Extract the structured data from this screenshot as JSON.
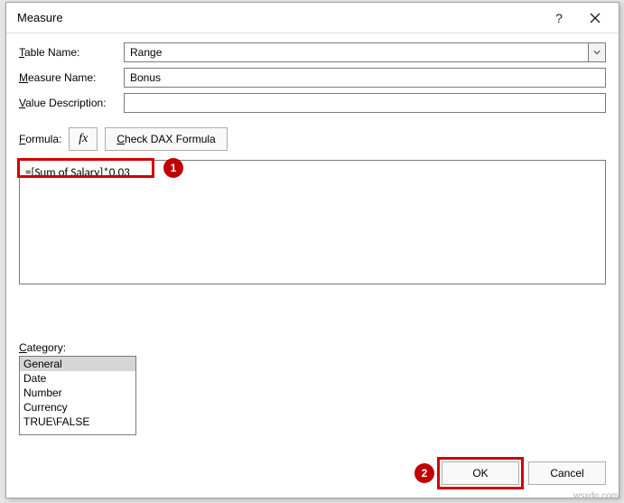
{
  "dialog": {
    "title": "Measure",
    "help_symbol": "?",
    "close_label": "Close"
  },
  "labels": {
    "table_name_pre": "T",
    "table_name_post": "able Name:",
    "measure_name_pre": "M",
    "measure_name_post": "easure Name:",
    "value_desc_pre": "V",
    "value_desc_post": "alue Description:",
    "formula_pre": "F",
    "formula_post": "ormula:",
    "category_pre": "C",
    "category_post": "ategory:"
  },
  "fields": {
    "table_name": "Range",
    "measure_name": "Bonus",
    "value_description": "",
    "formula": "=[Sum of Salary]*0.03"
  },
  "fx": "fx",
  "check_dax_pre": "C",
  "check_dax_post": "heck DAX Formula",
  "categories": [
    "General",
    "Date",
    "Number",
    "Currency",
    "TRUE\\FALSE"
  ],
  "footer": {
    "ok": "OK",
    "cancel": "Cancel"
  },
  "callouts": {
    "one": "1",
    "two": "2"
  },
  "watermark": "wsxdn.com"
}
